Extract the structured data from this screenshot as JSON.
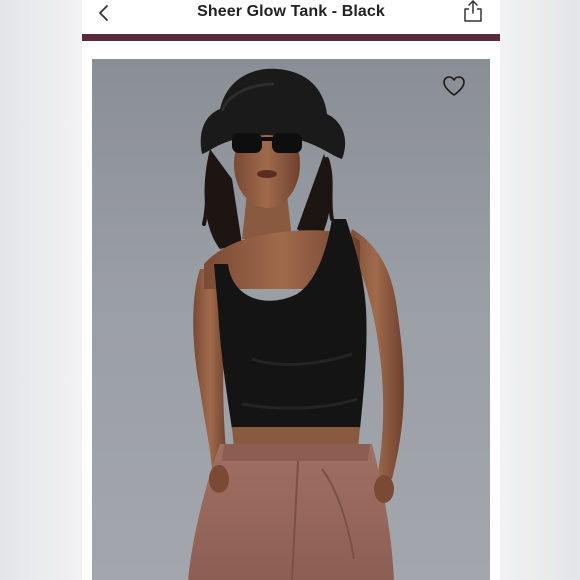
{
  "product": {
    "title": "Sheer Glow Tank - Black"
  },
  "icons": {
    "back": "chevron-left-icon",
    "share": "share-icon",
    "favorite": "heart-outline-icon"
  },
  "colors": {
    "accent_bar": "#5a2a3a",
    "photo_background": "#9a9ea5",
    "tank_color": "#141414",
    "pants_color": "#9a6a5f"
  }
}
